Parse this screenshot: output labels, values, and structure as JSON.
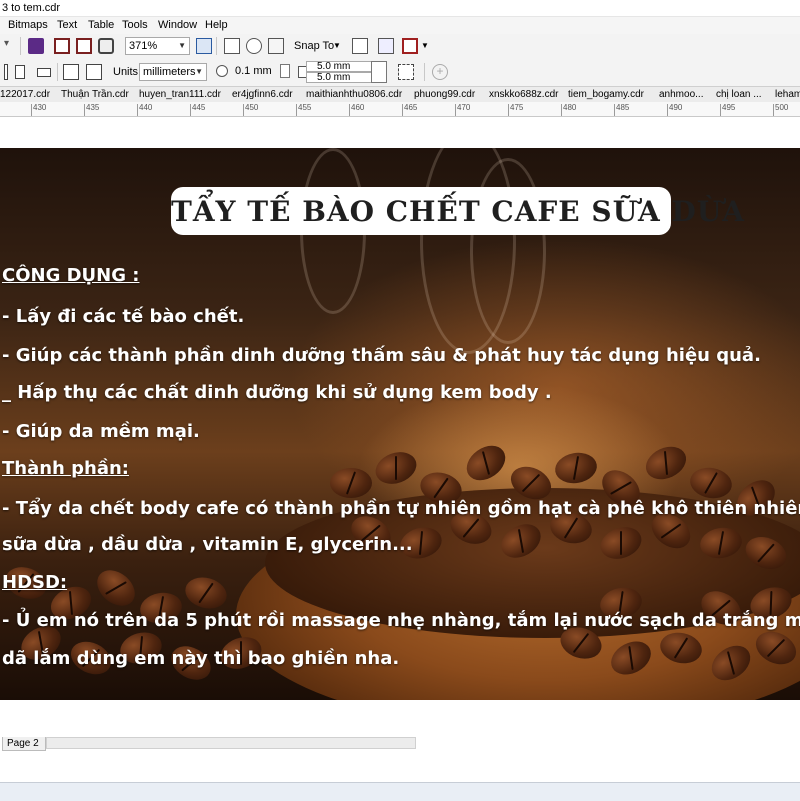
{
  "window": {
    "title": "3 to tem.cdr"
  },
  "menu": [
    "Bitmaps",
    "Text",
    "Table",
    "Tools",
    "Window",
    "Help"
  ],
  "toolbar": {
    "zoom": "371%",
    "snap_to": "Snap To",
    "units_label": "Units:",
    "units_value": "millimeters",
    "nudge": "0.1 mm",
    "dup_x": "5.0 mm",
    "dup_y": "5.0 mm"
  },
  "doc_tabs": [
    "122017.cdr",
    "Thuận Trần.cdr",
    "huyen_tran111.cdr",
    "er4jgfinn6.cdr",
    "maithianhthu0806.cdr",
    "phuong99.cdr",
    "xnskko688z.cdr",
    "tiem_bogamy.cdr",
    "anhmoo...",
    "chị loan ...",
    "leham"
  ],
  "ruler": [
    "430",
    "435",
    "440",
    "445",
    "450",
    "455",
    "460",
    "465",
    "470",
    "475",
    "480",
    "485",
    "490",
    "495",
    "500"
  ],
  "artwork": {
    "title": "TẨY TẾ BÀO CHẾT CAFE SỮA DỪA",
    "lines": [
      "CÔNG DỤNG :",
      "- Lấy đi các tế bào chết.",
      "- Giúp các thành phần dinh dưỡng thấm sâu & phát huy tác dụng hiệu quả.",
      "_ Hấp thụ các chất dinh dưỡng khi sử dụng kem body .",
      "- Giúp da mềm mại.",
      "Thành phần:",
      "- Tẩy da chết body cafe có thành phần tự nhiên gồm hạt cà phê khô thiên nhiên",
      "sữa dừa , dầu dừa , vitamin E, glycerin...",
      "HDSD:",
      "- Ủ em nó trên da 5 phút rồi massage nhẹ nhàng,  tắm lại nước sạch da trắng m",
      "dã lắm dùng em này thì bao ghiền nha."
    ]
  },
  "page_tab": "Page 2",
  "colors": {
    "accent_icon": "#5b2a86",
    "bean_dark": "#2a1206",
    "text_white": "#ffffff"
  }
}
